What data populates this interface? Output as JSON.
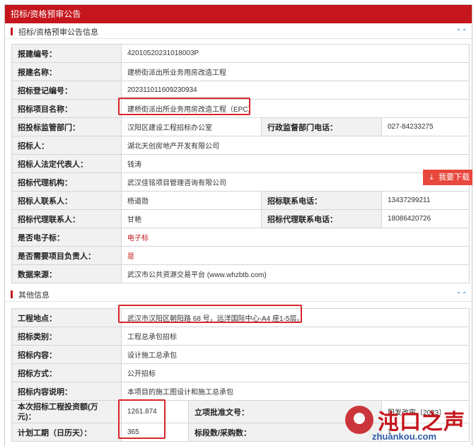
{
  "header": {
    "title": "招标/资格预审公告"
  },
  "section1": {
    "title": "招标/资格预审公告信息",
    "collapse_icon": "double-chevron-up",
    "rows": [
      {
        "label": "报建编号：",
        "value": "42010520231018003P"
      },
      {
        "label": "报建名称：",
        "value": "建桥街派出所业务用房改造工程"
      },
      {
        "label": "招标登记编号：",
        "value": "202311011609230934"
      },
      {
        "label": "招标项目名称：",
        "value": "建桥街派出所业务用房改造工程（EPC）"
      },
      {
        "label": "招投标监管部门：",
        "value": "汉阳区建设工程招标办公室",
        "label2": "行政监督部门电话：",
        "value2": "027-84233275"
      },
      {
        "label": "招标人：",
        "value": "湖北天创房地产开发有限公司"
      },
      {
        "label": "招标人法定代表人：",
        "value": "钱涛"
      },
      {
        "label": "招标代理机构：",
        "value": "武汉佳铭项目管理咨询有限公司"
      },
      {
        "label": "招标人联系人：",
        "value": "杨道勋",
        "label2": "招标联系电话：",
        "value2": "13437299211"
      },
      {
        "label": "招标代理联系人：",
        "value": "甘艳",
        "label2": "招标代理联系电话：",
        "value2": "18086420726"
      },
      {
        "label": "是否电子标：",
        "value": "电子标"
      },
      {
        "label": "是否需要项目负责人：",
        "value": "是"
      },
      {
        "label": "数据来源：",
        "value": "武汉市公共资源交易平台 (www.whzbtb.com)"
      }
    ]
  },
  "download": {
    "label": "我要下载",
    "icon": "download-icon"
  },
  "section2": {
    "title": "其他信息",
    "collapse_icon": "double-chevron-up",
    "rows": [
      {
        "label": "工程地点：",
        "value": "武汉市汉阳区朝阳路 68 号，远洋国际中心-A4 座1-5层。"
      },
      {
        "label": "招标类别：",
        "value": "工程总承包招标"
      },
      {
        "label": "招标内容：",
        "value": "设计施工总承包"
      },
      {
        "label": "招标方式：",
        "value": "公开招标"
      },
      {
        "label": "招标内容说明：",
        "value": "本项目的施工图设计和施工总承包"
      },
      {
        "label": "本次招标工程投资额(万元)：",
        "value": "1261.874",
        "label2": "立项批准文号：",
        "value2": "阳发改审〔2023〕"
      },
      {
        "label": "计划工期（日历天）：",
        "value": "365",
        "label2": "标段数/采购数：",
        "value2": "1"
      }
    ]
  },
  "watermark": {
    "brand": "沌口之声",
    "url": "zhuankou.com"
  },
  "colors": {
    "accent": "#c4161c",
    "highlight": "#d9252a",
    "download": "#e8473d",
    "label_bg": "#f1f1f1"
  }
}
